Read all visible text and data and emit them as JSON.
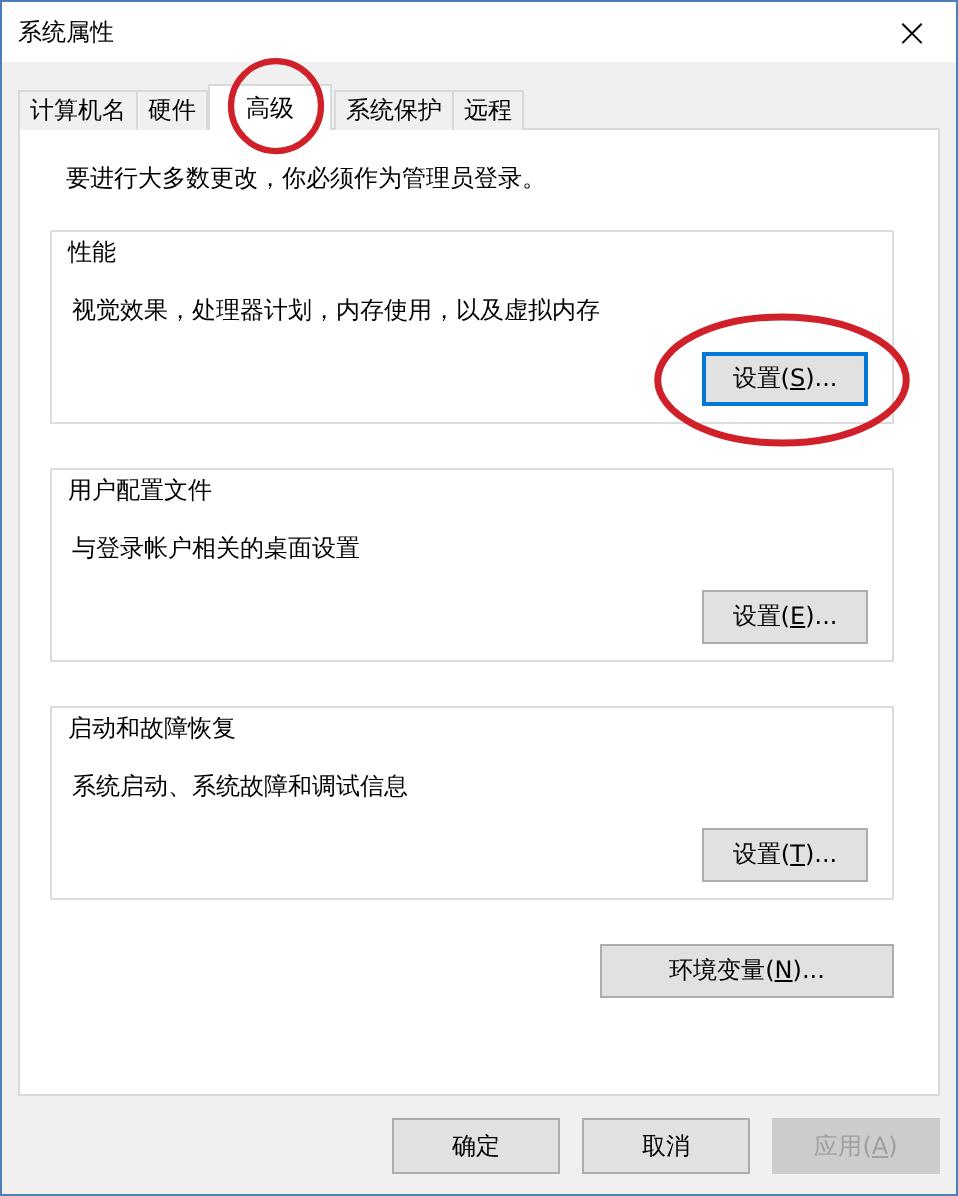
{
  "window": {
    "title": "系统属性",
    "close": "×"
  },
  "tabs": [
    {
      "label": "计算机名",
      "selected": false,
      "circled": false
    },
    {
      "label": "硬件",
      "selected": false,
      "circled": false
    },
    {
      "label": "高级",
      "selected": true,
      "circled": true
    },
    {
      "label": "系统保护",
      "selected": false,
      "circled": false
    },
    {
      "label": "远程",
      "selected": false,
      "circled": false
    }
  ],
  "notice": "要进行大多数更改，你必须作为管理员登录。",
  "groups": [
    {
      "title": "性能",
      "description": "视觉效果，处理器计划，内存使用，以及虚拟内存",
      "button": {
        "before": "设置(",
        "mnemonic": "S",
        "after": ")...",
        "focused": true,
        "circled": true
      }
    },
    {
      "title": "用户配置文件",
      "description": "与登录帐户相关的桌面设置",
      "button": {
        "before": "设置(",
        "mnemonic": "E",
        "after": ")...",
        "focused": false,
        "circled": false
      }
    },
    {
      "title": "启动和故障恢复",
      "description": "系统启动、系统故障和调试信息",
      "button": {
        "before": "设置(",
        "mnemonic": "T",
        "after": ")...",
        "focused": false,
        "circled": false
      }
    }
  ],
  "env_button": {
    "before": "环境变量(",
    "mnemonic": "N",
    "after": ")..."
  },
  "footer_buttons": [
    {
      "before": "确定",
      "disabled": false
    },
    {
      "before": "取消",
      "disabled": false
    },
    {
      "before": "应用(",
      "mnemonic": "A",
      "after": ")",
      "disabled": true
    }
  ]
}
